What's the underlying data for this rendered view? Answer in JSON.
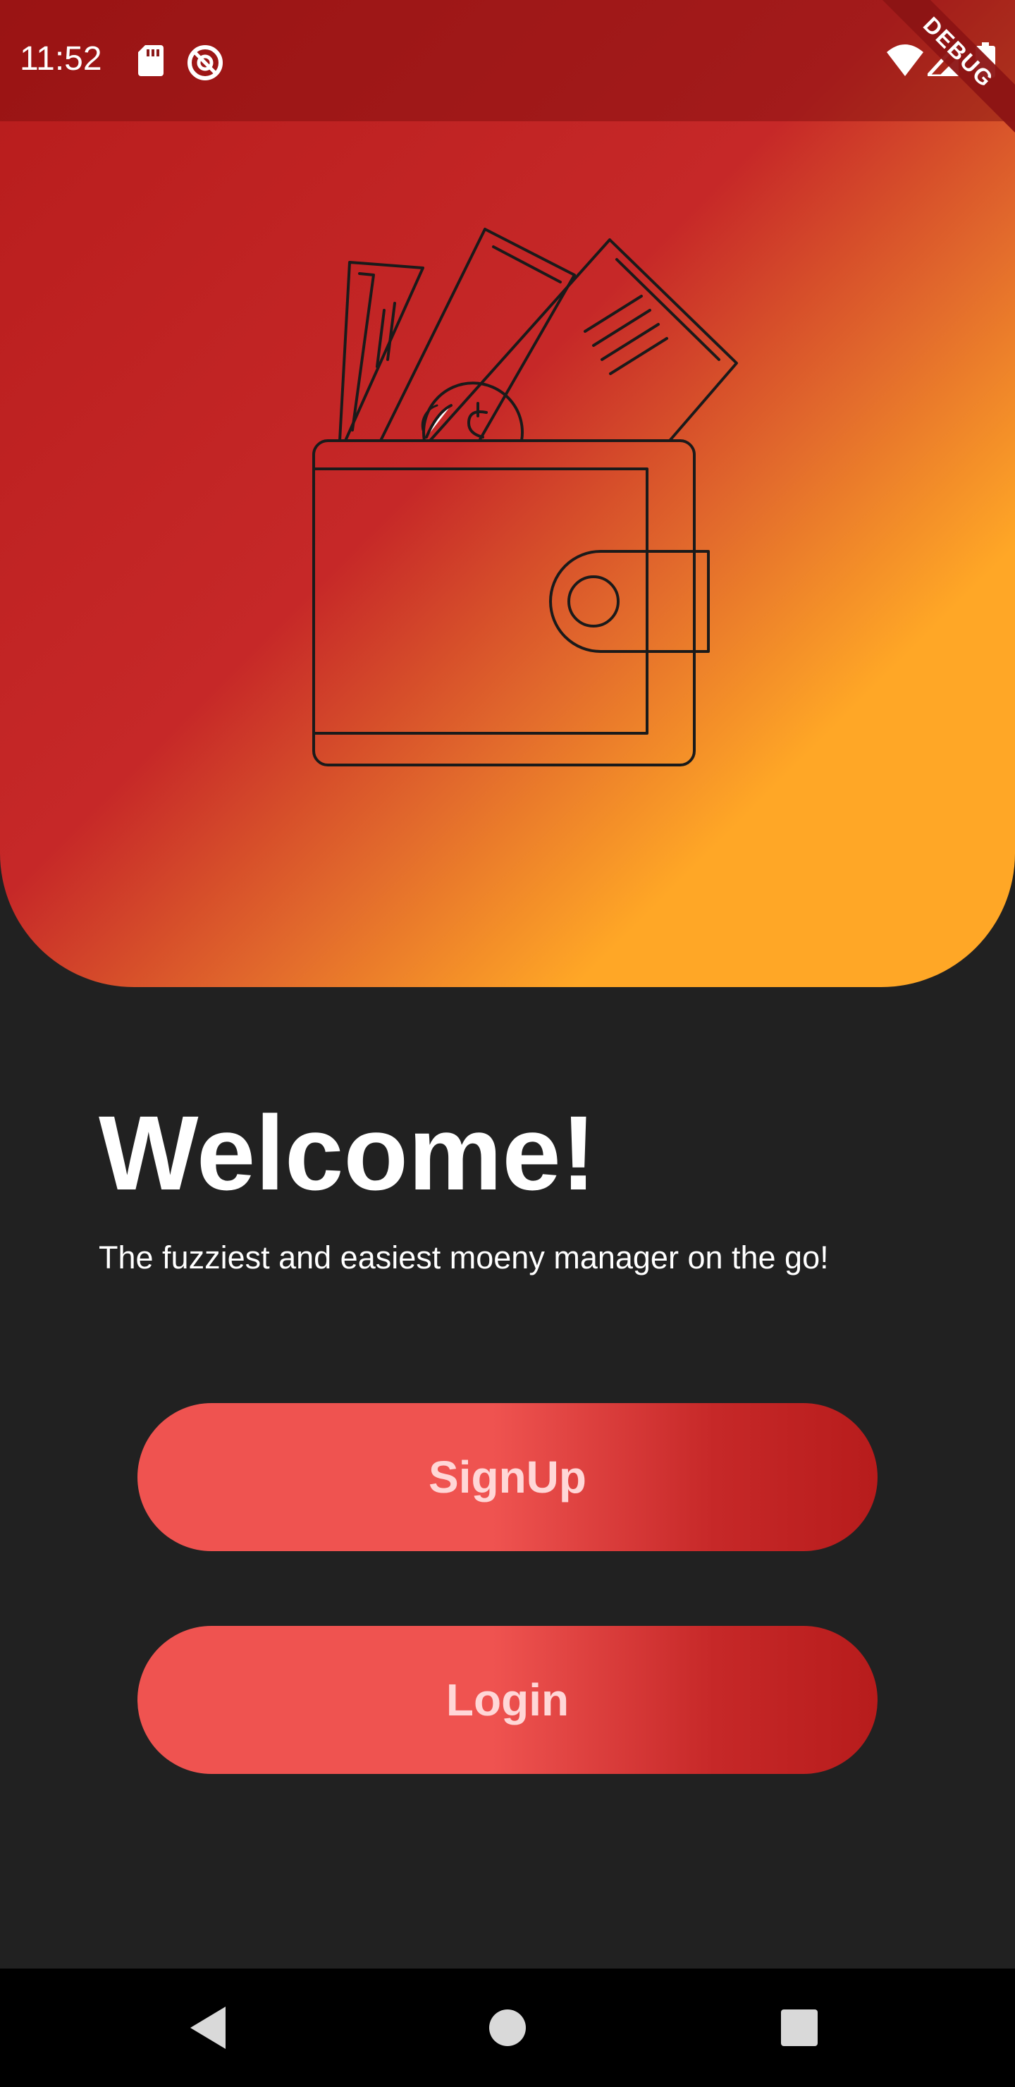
{
  "status_bar": {
    "time": "11:52",
    "icons": [
      "sd-card-icon",
      "do-not-disturb-icon",
      "wifi-icon",
      "signal-icon",
      "battery-icon"
    ],
    "debug_banner": "DEBUG"
  },
  "hero": {
    "illustration": "wallet-with-money-icon",
    "gradient_colors": [
      "#b71c1c",
      "#c62828",
      "#ffa726"
    ]
  },
  "welcome": {
    "title": "Welcome!",
    "subtitle": "The fuzziest and easiest moeny manager on the go!"
  },
  "buttons": {
    "signup_label": "SignUp",
    "login_label": "Login",
    "gradient_colors": [
      "#ef5350",
      "#b71c1c"
    ]
  },
  "nav_bar": {
    "icons": [
      "back-icon",
      "home-icon",
      "recent-apps-icon"
    ]
  },
  "colors": {
    "background": "#212121",
    "accent_red": "#c62828",
    "accent_orange": "#ffa726",
    "button_text": "#ffd7d7"
  }
}
